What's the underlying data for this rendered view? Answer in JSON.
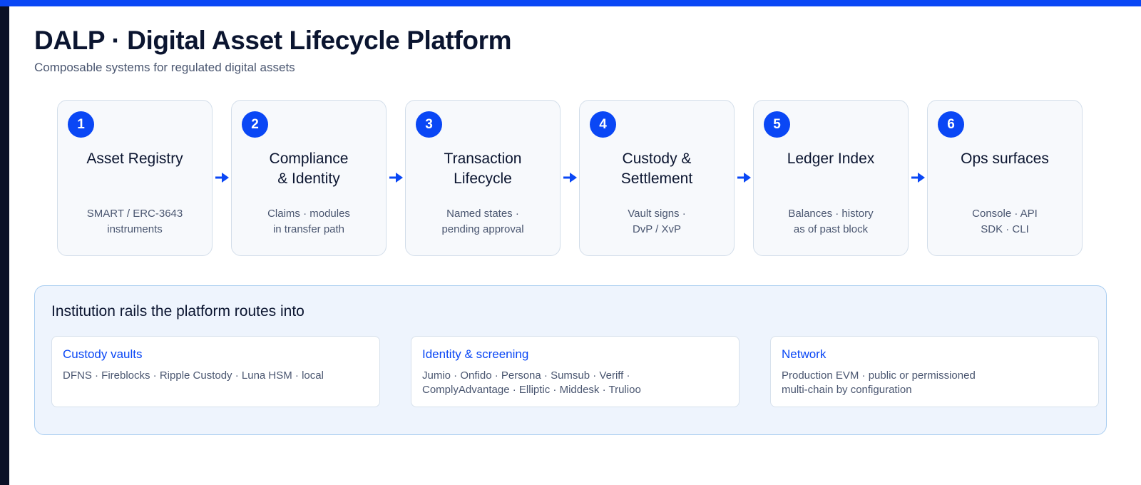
{
  "header": {
    "title": "DALP · Digital Asset Lifecycle Platform",
    "subtitle": "Composable systems for regulated digital assets"
  },
  "colors": {
    "accent": "#0a47f5",
    "dark_edge": "#0a1026",
    "card_border": "#d3deea",
    "panel_fill": "#eef4fd",
    "panel_border": "#a9cdf0"
  },
  "steps": [
    {
      "number": "1",
      "title": "Asset Registry",
      "desc": "SMART / ERC-3643\ninstruments"
    },
    {
      "number": "2",
      "title": "Compliance\n& Identity",
      "desc": "Claims · modules\nin transfer path"
    },
    {
      "number": "3",
      "title": "Transaction\nLifecycle",
      "desc": "Named states ·\npending approval"
    },
    {
      "number": "4",
      "title": "Custody &\nSettlement",
      "desc": "Vault signs ·\nDvP / XvP"
    },
    {
      "number": "5",
      "title": "Ledger Index",
      "desc": "Balances · history\nas of past block"
    },
    {
      "number": "6",
      "title": "Ops surfaces",
      "desc": "Console · API\nSDK · CLI"
    }
  ],
  "rails": {
    "title": "Institution rails the platform routes into",
    "items": [
      {
        "title": "Custody vaults",
        "desc": "DFNS · Fireblocks · Ripple Custody · Luna HSM · local"
      },
      {
        "title": "Identity & screening",
        "desc": "Jumio · Onfido · Persona · Sumsub · Veriff ·\nComplyAdvantage · Elliptic · Middesk · Trulioo"
      },
      {
        "title": "Network",
        "desc": "Production EVM · public or permissioned\nmulti-chain by configuration"
      }
    ]
  }
}
